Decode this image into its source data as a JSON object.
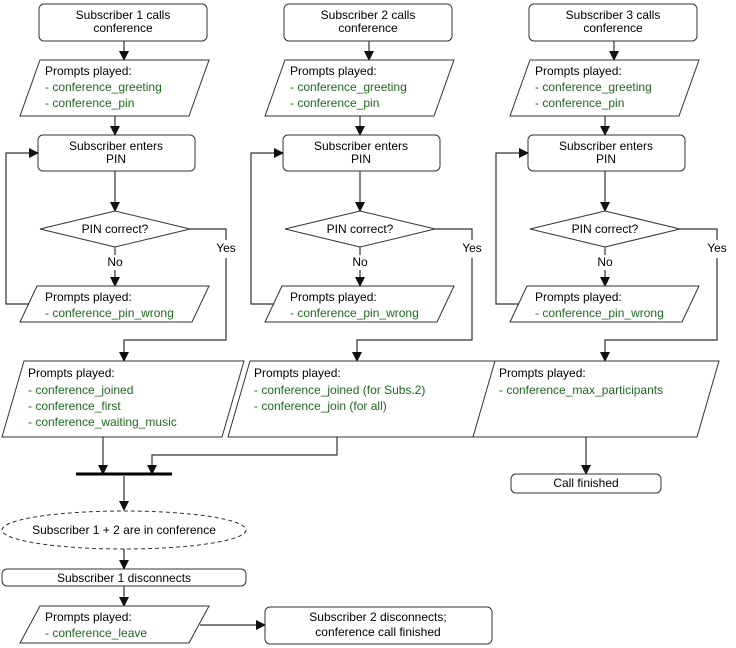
{
  "columns": [
    {
      "start": [
        "Subscriber 1 calls",
        "conference"
      ],
      "prompts1_header": "Prompts played:",
      "prompts1": [
        "- conference_greeting",
        "- conference_pin"
      ],
      "enter_pin": [
        "Subscriber enters",
        "PIN"
      ],
      "decision": "PIN correct?",
      "no_label": "No",
      "yes_label": "Yes",
      "wrong_header": "Prompts played:",
      "wrong": [
        "- conference_pin_wrong"
      ],
      "result_header": "Prompts played:",
      "result": [
        "- conference_joined",
        "- conference_first",
        "- conference_waiting_music"
      ]
    },
    {
      "start": [
        "Subscriber 2 calls",
        "conference"
      ],
      "prompts1_header": "Prompts played:",
      "prompts1": [
        "- conference_greeting",
        "- conference_pin"
      ],
      "enter_pin": [
        "Subscriber enters",
        "PIN"
      ],
      "decision": "PIN correct?",
      "no_label": "No",
      "yes_label": "Yes",
      "wrong_header": "Prompts played:",
      "wrong": [
        "- conference_pin_wrong"
      ],
      "result_header": "Prompts played:",
      "result": [
        "- conference_joined (for Subs.2)",
        "- conference_join (for all)"
      ]
    },
    {
      "start": [
        "Subscriber 3 calls",
        "conference"
      ],
      "prompts1_header": "Prompts played:",
      "prompts1": [
        "- conference_greeting",
        "- conference_pin"
      ],
      "enter_pin": [
        "Subscriber enters",
        "PIN"
      ],
      "decision": "PIN correct?",
      "no_label": "No",
      "yes_label": "Yes",
      "wrong_header": "Prompts played:",
      "wrong": [
        "- conference_pin_wrong"
      ],
      "result_header": "Prompts played:",
      "result": [
        "- conference_max_participants"
      ]
    }
  ],
  "call_finished": "Call finished",
  "in_conference": "Subscriber 1 + 2 are in conference",
  "disconnects": "Subscriber 1 disconnects",
  "leave_header": "Prompts played:",
  "leave": [
    "- conference_leave"
  ],
  "final": [
    "Subscriber 2 disconnects;",
    "conference call finished"
  ],
  "colors": {
    "prompt_text": "#1e6b1e",
    "stroke": "#333333"
  }
}
